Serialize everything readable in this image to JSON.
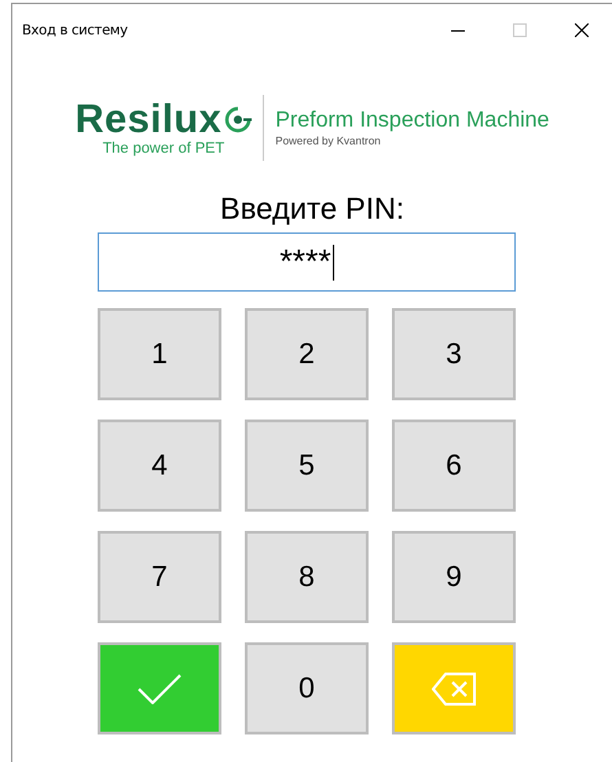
{
  "window": {
    "title": "Вход в систему"
  },
  "logo": {
    "brand": "Resilux",
    "tagline": "The power of PET",
    "product": "Preform Inspection Machine",
    "credit": "Powered by Kvantron"
  },
  "prompt": "Введите PIN:",
  "pin_field": {
    "value": "****"
  },
  "keys": [
    {
      "kind": "digit",
      "label": "1"
    },
    {
      "kind": "digit",
      "label": "2"
    },
    {
      "kind": "digit",
      "label": "3"
    },
    {
      "kind": "digit",
      "label": "4"
    },
    {
      "kind": "digit",
      "label": "5"
    },
    {
      "kind": "digit",
      "label": "6"
    },
    {
      "kind": "digit",
      "label": "7"
    },
    {
      "kind": "digit",
      "label": "8"
    },
    {
      "kind": "digit",
      "label": "9"
    },
    {
      "kind": "confirm"
    },
    {
      "kind": "digit",
      "label": "0"
    },
    {
      "kind": "backspace"
    }
  ]
}
